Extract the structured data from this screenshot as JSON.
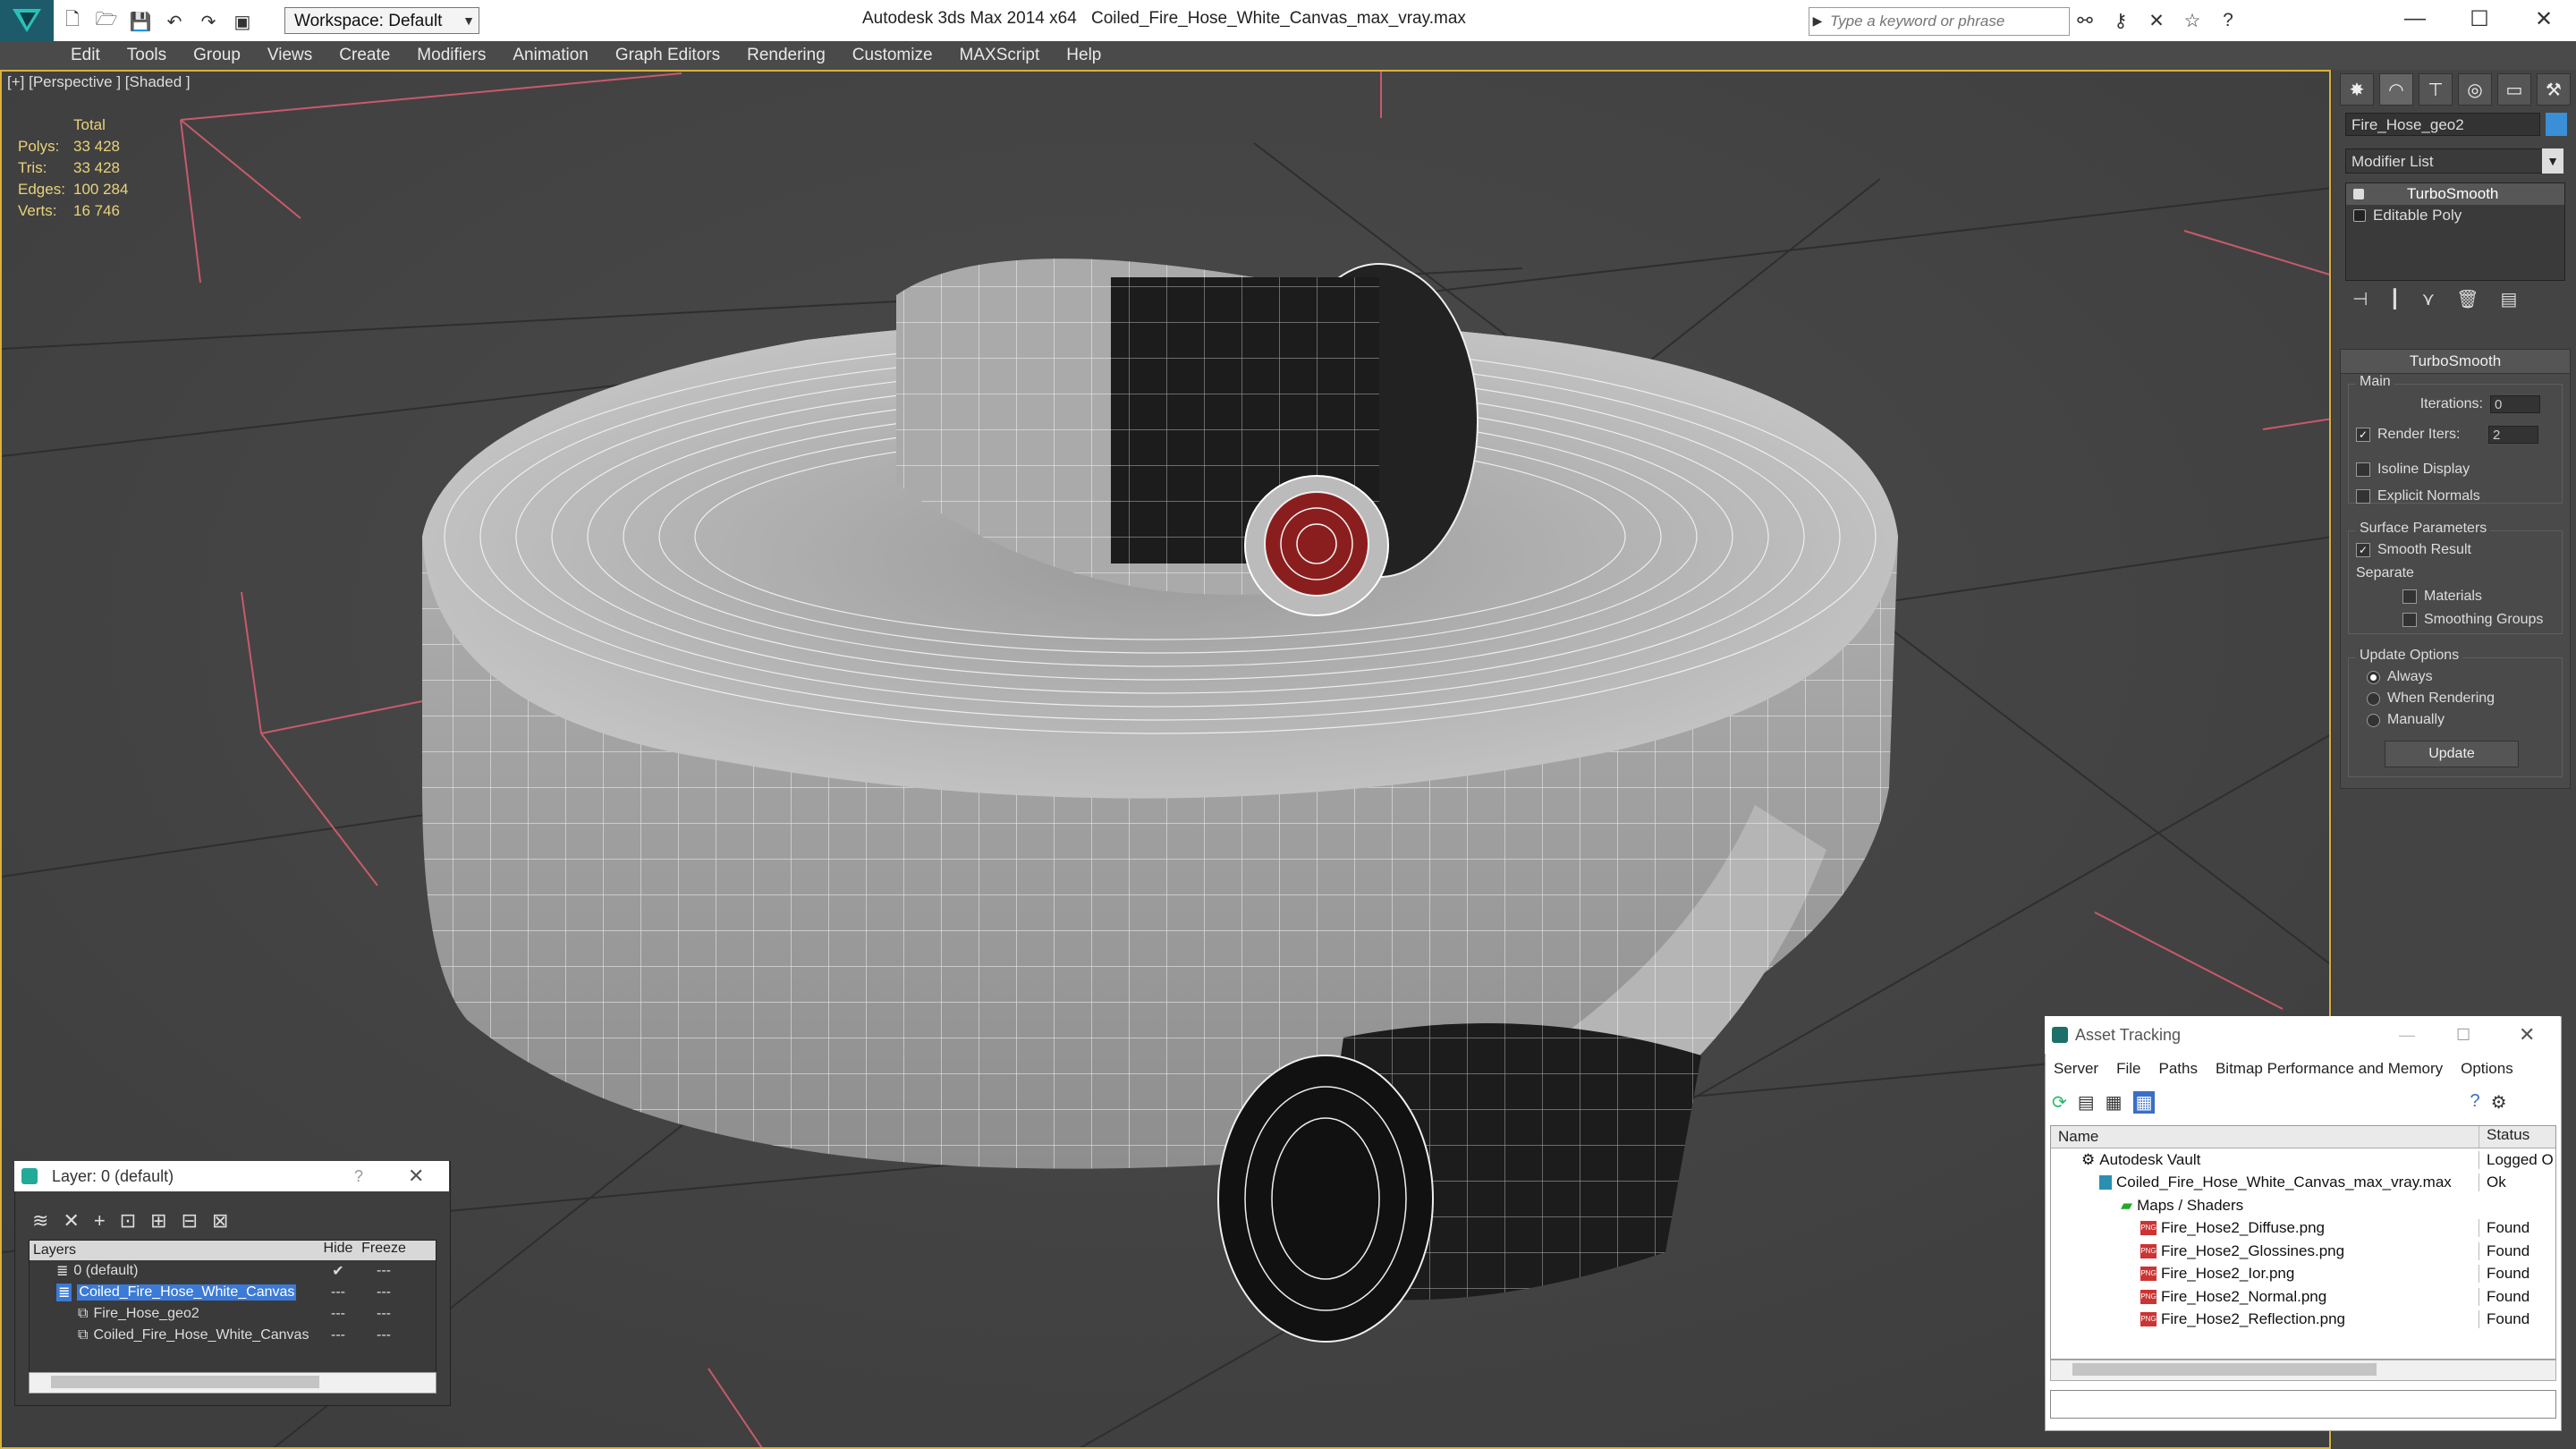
{
  "titlebar": {
    "workspace": "Workspace: Default",
    "app_title": "Autodesk 3ds Max  2014 x64",
    "file_title": "Coiled_Fire_Hose_White_Canvas_max_vray.max",
    "search_placeholder": "Type a keyword or phrase"
  },
  "menu": [
    "Edit",
    "Tools",
    "Group",
    "Views",
    "Create",
    "Modifiers",
    "Animation",
    "Graph Editors",
    "Rendering",
    "Customize",
    "MAXScript",
    "Help"
  ],
  "viewport": {
    "label": "[+] [Perspective ] [Shaded ]",
    "stats": {
      "header": "Total",
      "polys_label": "Polys:",
      "polys": "33 428",
      "tris_label": "Tris:",
      "tris": "33 428",
      "edges_label": "Edges:",
      "edges": "100 284",
      "verts_label": "Verts:",
      "verts": "16 746"
    }
  },
  "command_panel": {
    "object_name": "Fire_Hose_geo2",
    "object_color": "#3a8fd6",
    "modifier_list": "Modifier List",
    "stack": [
      "TurboSmooth",
      "Editable Poly"
    ],
    "rollout_title": "TurboSmooth",
    "main_group": "Main",
    "iterations_label": "Iterations:",
    "iterations": "0",
    "render_iters_label": "Render Iters:",
    "render_iters": "2",
    "isoline": "Isoline Display",
    "explicit_normals": "Explicit Normals",
    "surface_group": "Surface Parameters",
    "smooth_result": "Smooth Result",
    "separate": "Separate",
    "materials": "Materials",
    "smoothing_groups": "Smoothing Groups",
    "update_group": "Update Options",
    "always": "Always",
    "when_rendering": "When Rendering",
    "manually": "Manually",
    "update_btn": "Update"
  },
  "layer_dialog": {
    "title": "Layer: 0 (default)",
    "help": "?",
    "col_layers": "Layers",
    "col_hide": "Hide",
    "col_freeze": "Freeze",
    "rows": [
      "0 (default)",
      "Coiled_Fire_Hose_White_Canvas",
      "Fire_Hose_geo2",
      "Coiled_Fire_Hose_White_Canvas"
    ]
  },
  "asset_dialog": {
    "title": "Asset Tracking",
    "menu": [
      "Server",
      "File",
      "Paths",
      "Bitmap Performance and Memory",
      "Options"
    ],
    "col_name": "Name",
    "col_status": "Status",
    "rows": [
      {
        "name": "Autodesk Vault",
        "status": "Logged O"
      },
      {
        "name": "Coiled_Fire_Hose_White_Canvas_max_vray.max",
        "status": "Ok"
      },
      {
        "name": "Maps / Shaders",
        "status": ""
      },
      {
        "name": "Fire_Hose2_Diffuse.png",
        "status": "Found"
      },
      {
        "name": "Fire_Hose2_Glossines.png",
        "status": "Found"
      },
      {
        "name": "Fire_Hose2_Ior.png",
        "status": "Found"
      },
      {
        "name": "Fire_Hose2_Normal.png",
        "status": "Found"
      },
      {
        "name": "Fire_Hose2_Reflection.png",
        "status": "Found"
      }
    ]
  }
}
